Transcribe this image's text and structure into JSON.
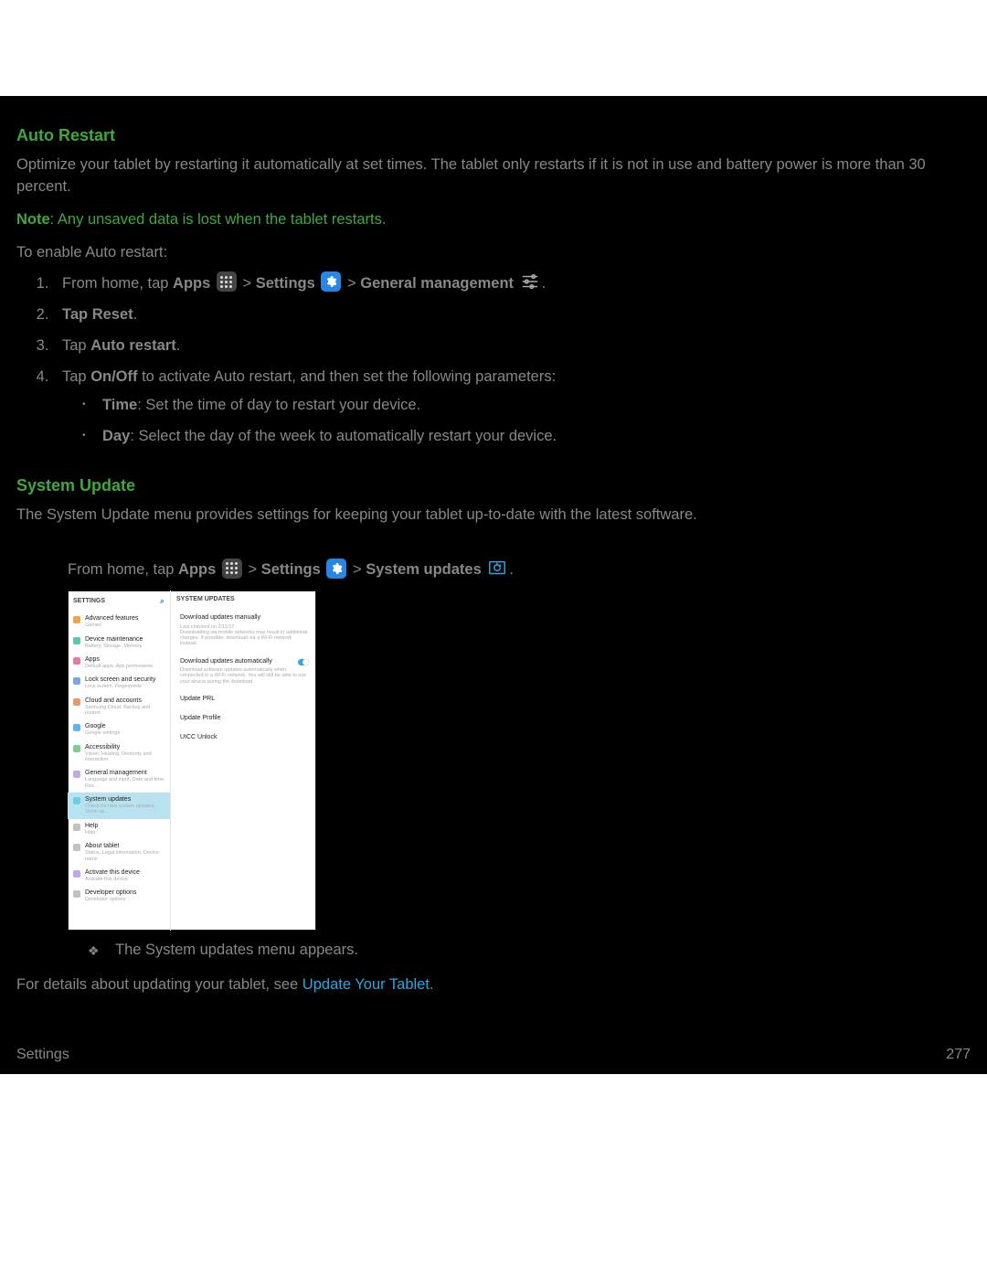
{
  "auto_restart": {
    "heading": "Auto Restart",
    "intro": "Optimize your tablet by restarting it automatically at set times. The tablet only restarts if it is not in use and battery power is more than 30 percent.",
    "note_label": "Note",
    "note_text": ": Any unsaved data is lost when the tablet restarts.",
    "lead": "To enable Auto restart:",
    "step1_pre": "From home, tap ",
    "apps": "Apps",
    "sep": " > ",
    "settings": "Settings",
    "gen_mgmt": "General management",
    "step2_pre": "Tap ",
    "step2_bold": "Reset",
    "step3_pre": "Tap ",
    "step3_bold": "Auto restart",
    "step4_pre": "Tap ",
    "step4_bold": "On/Off",
    "step4_post": " to activate Auto restart, and then set the following parameters:",
    "bullet_time_bold": "Time",
    "bullet_time_text": ": Set the time of day to restart your device.",
    "bullet_day_bold": "Day",
    "bullet_day_text": ": Select the day of the week to automatically restart your device."
  },
  "system_update": {
    "heading": "System Update",
    "intro": "The System Update menu provides settings for keeping your tablet up-to-date with the latest software.",
    "step1_pre": "From home, tap ",
    "apps": "Apps",
    "sep": " > ",
    "settings": "Settings",
    "sys_updates": "System updates",
    "result": "The System updates menu appears.",
    "details_pre": "For details about updating your tablet, see ",
    "details_link": "Update Your Tablet",
    "details_post": "."
  },
  "screenshot": {
    "left_header": "SETTINGS",
    "right_header": "SYSTEM UPDATES",
    "left_items": [
      {
        "icon": "#e7a84a",
        "t1": "Advanced features",
        "t2": "Games"
      },
      {
        "icon": "#5fc7b0",
        "t1": "Device maintenance",
        "t2": "Battery, Storage, Memory"
      },
      {
        "icon": "#e77aa6",
        "t1": "Apps",
        "t2": "Default apps, App permissions"
      },
      {
        "icon": "#7aa6e7",
        "t1": "Lock screen and security",
        "t2": "Lock screen, Fingerprints"
      },
      {
        "icon": "#e79a6a",
        "t1": "Cloud and accounts",
        "t2": "Samsung Cloud, Backup and restore"
      },
      {
        "icon": "#6ab3e7",
        "t1": "Google",
        "t2": "Google settings"
      },
      {
        "icon": "#7ecf8f",
        "t1": "Accessibility",
        "t2": "Vision, Hearing, Dexterity and interaction"
      },
      {
        "icon": "#c5a8e7",
        "t1": "General management",
        "t2": "Language and input, Date and time, Res…"
      },
      {
        "icon": "#6acfe7",
        "t1": "System updates",
        "t2": "Check for new system updates, Show up…",
        "sel": true
      },
      {
        "icon": "#c2c2c2",
        "t1": "Help",
        "t2": "Help"
      },
      {
        "icon": "#c2c2c2",
        "t1": "About tablet",
        "t2": "Status, Legal information, Device name"
      },
      {
        "icon": "#c5a8e7",
        "t1": "Activate this device",
        "t2": "Activate this device"
      },
      {
        "icon": "#c2c2c2",
        "t1": "Developer options",
        "t2": "Developer options"
      }
    ],
    "right_items": [
      {
        "t1": "Download updates manually",
        "t2": "Last checked on 2/11/17\nDownloading via mobile networks may result in additional charges. If possible, download via a Wi-Fi network instead."
      },
      {
        "t1": "Download updates automatically",
        "t2": "Download software updates automatically when connected to a Wi-Fi network. You will still be able to use your device during the download.",
        "toggle": true
      },
      {
        "t1": "Update PRL"
      },
      {
        "t1": "Update Profile"
      },
      {
        "t1": "UICC Unlock"
      }
    ]
  },
  "footer": {
    "left": "Settings",
    "right": "277"
  }
}
